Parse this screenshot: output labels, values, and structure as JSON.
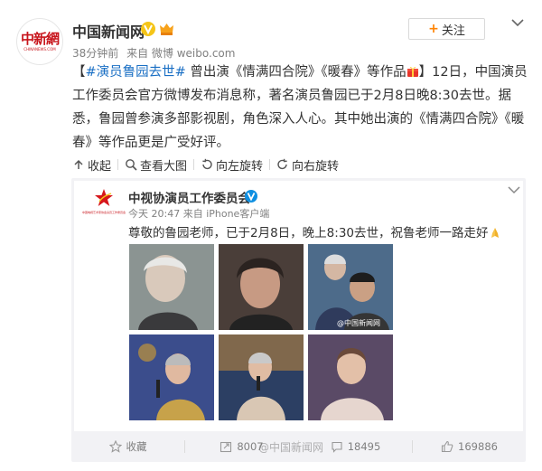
{
  "author": {
    "name": "中国新闻网",
    "logo_text": "中新網",
    "logo_subtext": "CHINANEWS.COM",
    "time": "38分钟前",
    "source": "来自 微博 weibo.com",
    "follow_label": "关注"
  },
  "post": {
    "bracket_open": "【",
    "hashtag": "#演员鲁园去世#",
    "title_text": " 曾出演《情满四合院》《暖春》等作品",
    "bracket_close": "】",
    "body": "12日，中国演员工作委员会官方微博发布消息称，著名演员鲁园已于2月8日晚8:30去世。据悉，鲁园曾参演多部影视剧，角色深入人心。其中她出演的《情满四合院》《暖春》等作品更是广受好评。"
  },
  "toolbar": {
    "collapse_label": "收起",
    "view_large_label": "查看大图",
    "rotate_left_label": "向左旋转",
    "rotate_right_label": "向右旋转"
  },
  "forwarded": {
    "name": "中视协演员工作委员会",
    "logo_subtext": "中国电视艺术家协会演员工作委员会",
    "time": "今天 20:47",
    "source": "来自 iPhone客户端",
    "text": "尊敬的鲁园老师，已于2月8日，晚上8:30去世，祝鲁老师一路走好",
    "photo_watermark": "@中国新闻网",
    "collect_label": "收藏",
    "repost_count": "8007",
    "comment_count": "18495",
    "like_count": "169886"
  },
  "page_watermark": "@中国新闻网",
  "colors": {
    "accent_orange": "#ff8200",
    "link_blue": "#1a6fc4",
    "brand_red": "#c8161d",
    "verified_yellow": "#f5c518",
    "verified_blue": "#0e8fe1"
  }
}
